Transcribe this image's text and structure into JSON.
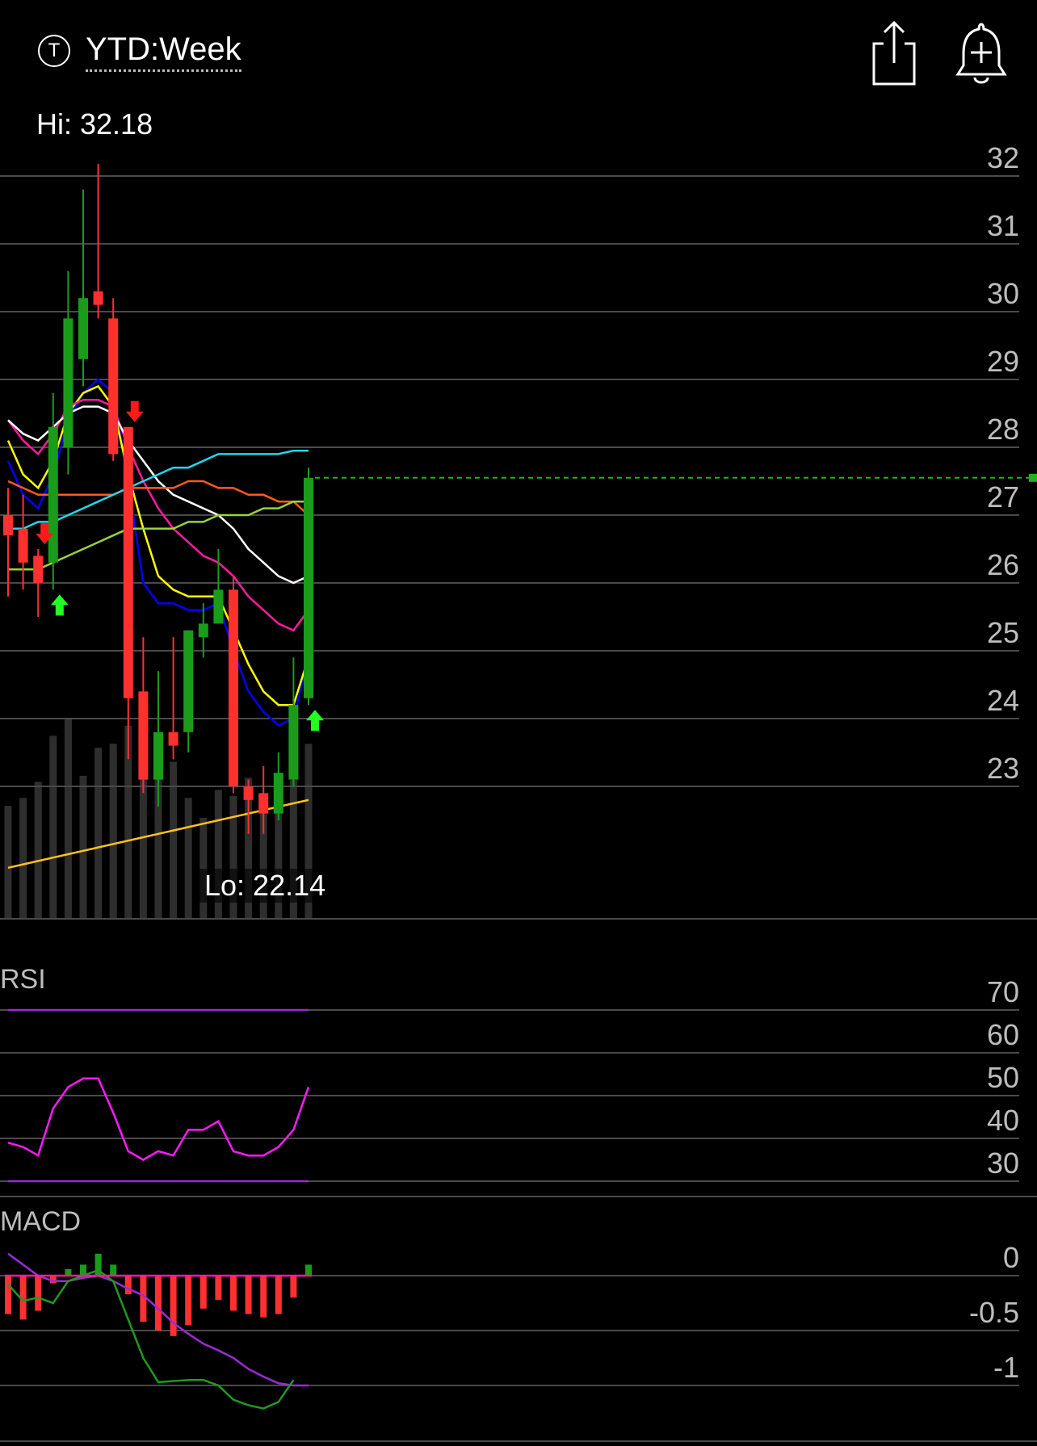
{
  "header": {
    "ticker_icon": "T",
    "range_title": "YTD:Week",
    "share_icon": "share-icon",
    "alert_icon": "add-alert-bell-icon"
  },
  "colors": {
    "background": "#000000",
    "up": "#1a9c1a",
    "down": "#ff3030",
    "grid": "#4a4a4a",
    "signal_up": "#22ff22",
    "signal_down": "#ff1a1a"
  },
  "chart_data": [
    {
      "type": "candlestick",
      "panel": "price",
      "hi_label": "Hi: 32.18",
      "lo_label": "Lo: 22.14",
      "y_ticks": [
        23,
        24,
        25,
        26,
        27,
        28,
        29,
        30,
        31,
        32
      ],
      "ylim": [
        22.14,
        32.18
      ],
      "last_price": 27.55,
      "candles": [
        {
          "open": 27.0,
          "close": 26.7,
          "high": 27.4,
          "low": 25.8
        },
        {
          "open": 26.8,
          "close": 26.3,
          "high": 27.3,
          "low": 25.9
        },
        {
          "open": 26.4,
          "close": 26.0,
          "high": 26.5,
          "low": 25.5
        },
        {
          "open": 26.3,
          "close": 28.3,
          "high": 28.8,
          "low": 25.9
        },
        {
          "open": 28.0,
          "close": 29.9,
          "high": 30.6,
          "low": 27.6
        },
        {
          "open": 29.3,
          "close": 30.2,
          "high": 31.8,
          "low": 28.9
        },
        {
          "open": 30.3,
          "close": 30.1,
          "high": 32.18,
          "low": 29.9
        },
        {
          "open": 29.9,
          "close": 27.9,
          "high": 30.2,
          "low": 27.8
        },
        {
          "open": 28.3,
          "close": 24.3,
          "high": 28.3,
          "low": 23.4
        },
        {
          "open": 24.4,
          "close": 23.1,
          "high": 25.2,
          "low": 22.9
        },
        {
          "open": 23.1,
          "close": 23.8,
          "high": 24.7,
          "low": 22.7
        },
        {
          "open": 23.8,
          "close": 23.6,
          "high": 25.2,
          "low": 23.4
        },
        {
          "open": 23.8,
          "close": 25.3,
          "high": 25.3,
          "low": 23.5
        },
        {
          "open": 25.2,
          "close": 25.4,
          "high": 25.7,
          "low": 24.9
        },
        {
          "open": 25.4,
          "close": 25.9,
          "high": 26.5,
          "low": 25.4
        },
        {
          "open": 25.9,
          "close": 23.0,
          "high": 26.1,
          "low": 22.9
        },
        {
          "open": 23.0,
          "close": 22.8,
          "high": 23.1,
          "low": 22.3
        },
        {
          "open": 22.9,
          "close": 22.6,
          "high": 23.3,
          "low": 22.3
        },
        {
          "open": 22.6,
          "close": 23.2,
          "high": 23.5,
          "low": 22.5
        },
        {
          "open": 23.1,
          "close": 24.2,
          "high": 24.9,
          "low": 23.0
        },
        {
          "open": 24.3,
          "close": 27.55,
          "high": 27.7,
          "low": 24.2
        }
      ],
      "volume": [
        0.56,
        0.6,
        0.68,
        0.91,
        1.0,
        0.71,
        0.85,
        0.87,
        0.96,
        0.86,
        0.72,
        0.78,
        0.6,
        0.5,
        0.64,
        0.61,
        0.7,
        0.58,
        0.55,
        0.69,
        0.87
      ],
      "moving_averages": [
        {
          "color": "#0000ff",
          "values": [
            27.8,
            27.3,
            27.1,
            27.6,
            28.4,
            28.8,
            29.0,
            28.8,
            27.5,
            26.0,
            25.7,
            25.7,
            25.6,
            25.6,
            25.7,
            25.0,
            24.4,
            24.1,
            23.9,
            24.0,
            24.9
          ]
        },
        {
          "color": "#ffff00",
          "values": [
            28.1,
            27.6,
            27.4,
            27.8,
            28.5,
            28.8,
            28.9,
            28.6,
            27.6,
            26.8,
            26.1,
            25.9,
            25.8,
            25.8,
            25.8,
            25.3,
            24.8,
            24.4,
            24.2,
            24.2,
            24.9
          ]
        },
        {
          "color": "#ff1aa0",
          "values": [
            28.4,
            28.1,
            27.9,
            28.2,
            28.6,
            28.7,
            28.7,
            28.6,
            28.0,
            27.5,
            27.1,
            26.8,
            26.6,
            26.4,
            26.3,
            26.1,
            25.8,
            25.6,
            25.4,
            25.3,
            25.6
          ]
        },
        {
          "color": "#ffffff",
          "values": [
            28.4,
            28.2,
            28.1,
            28.3,
            28.5,
            28.6,
            28.6,
            28.5,
            28.1,
            27.8,
            27.5,
            27.3,
            27.2,
            27.1,
            27.0,
            26.8,
            26.5,
            26.3,
            26.1,
            26.0,
            26.1
          ]
        },
        {
          "color": "#ff5a1e",
          "values": [
            27.5,
            27.4,
            27.3,
            27.3,
            27.3,
            27.3,
            27.3,
            27.3,
            27.4,
            27.4,
            27.4,
            27.4,
            27.5,
            27.5,
            27.4,
            27.4,
            27.3,
            27.3,
            27.2,
            27.2,
            27.0
          ]
        },
        {
          "color": "#9ad23c",
          "values": [
            26.2,
            26.2,
            26.2,
            26.3,
            26.4,
            26.5,
            26.6,
            26.7,
            26.8,
            26.8,
            26.8,
            26.8,
            26.9,
            26.9,
            27.0,
            27.0,
            27.0,
            27.1,
            27.1,
            27.2,
            27.2
          ]
        },
        {
          "color": "#22d7ee",
          "values": [
            26.8,
            26.8,
            26.9,
            26.9,
            27.0,
            27.1,
            27.2,
            27.3,
            27.4,
            27.5,
            27.6,
            27.7,
            27.7,
            27.8,
            27.9,
            27.9,
            27.9,
            27.9,
            27.9,
            27.95,
            27.95
          ]
        },
        {
          "color": "#ffc21a",
          "values": [
            21.8,
            21.85,
            21.9,
            21.95,
            22.0,
            22.05,
            22.1,
            22.15,
            22.2,
            22.25,
            22.3,
            22.35,
            22.4,
            22.45,
            22.5,
            22.55,
            22.6,
            22.65,
            22.7,
            22.75,
            22.8
          ]
        }
      ],
      "signals": [
        {
          "index": 2,
          "direction": "down"
        },
        {
          "index": 3,
          "direction": "up"
        },
        {
          "index": 8,
          "direction": "down"
        },
        {
          "index": 20,
          "direction": "up"
        }
      ]
    },
    {
      "type": "line",
      "panel": "rsi",
      "label": "RSI",
      "y_ticks": [
        70,
        60,
        50,
        40,
        30
      ],
      "ylim": [
        30,
        70
      ],
      "bands": [
        70,
        30
      ],
      "values": [
        39,
        38,
        36,
        47,
        52,
        54,
        54,
        46,
        37,
        35,
        37,
        36,
        42,
        42,
        44,
        37,
        36,
        36,
        38,
        42,
        52
      ]
    },
    {
      "type": "bar",
      "panel": "macd",
      "label": "MACD",
      "y_ticks": [
        "0",
        "-0.5",
        "-1"
      ],
      "ylim": [
        -1.3,
        0.2
      ],
      "histogram": [
        -0.35,
        -0.4,
        -0.32,
        -0.07,
        0.06,
        0.1,
        0.2,
        0.1,
        -0.17,
        -0.42,
        -0.5,
        -0.55,
        -0.45,
        -0.3,
        -0.22,
        -0.32,
        -0.35,
        -0.38,
        -0.35,
        -0.2,
        0.1
      ],
      "macd_line": [
        -0.08,
        -0.23,
        -0.2,
        -0.25,
        -0.05,
        0.0,
        0.05,
        -0.05,
        -0.4,
        -0.75,
        -0.97,
        -0.96,
        -0.95,
        -0.95,
        -1.0,
        -1.13,
        -1.18,
        -1.21,
        -1.15,
        -0.95
      ],
      "signal_line": [
        0.2,
        0.1,
        0.0,
        -0.05,
        -0.05,
        -0.02,
        0.0,
        -0.05,
        -0.12,
        -0.18,
        -0.3,
        -0.43,
        -0.53,
        -0.62,
        -0.68,
        -0.75,
        -0.85,
        -0.92,
        -0.98,
        -1.0,
        -1.0
      ]
    }
  ]
}
